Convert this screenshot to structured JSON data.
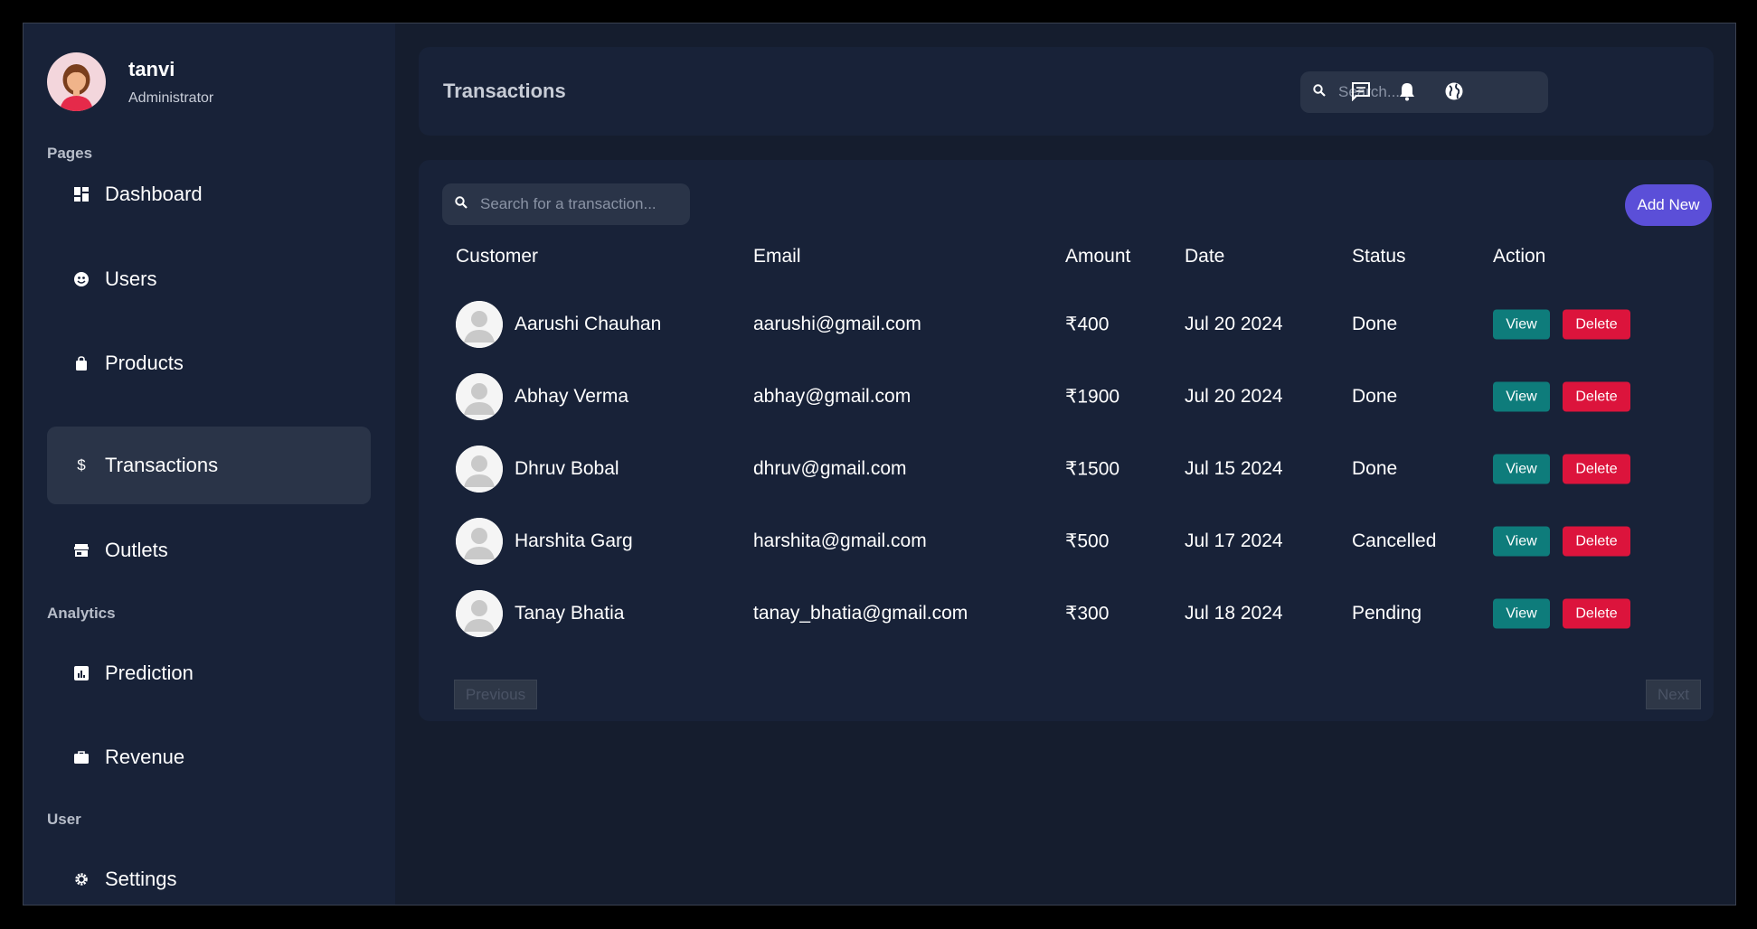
{
  "profile": {
    "name": "tanvi",
    "role": "Administrator"
  },
  "sidebar": {
    "sections": {
      "pages": "Pages",
      "analytics": "Analytics",
      "user": "User"
    },
    "items": [
      {
        "label": "Dashboard",
        "icon": "dashboard-icon"
      },
      {
        "label": "Users",
        "icon": "users-icon"
      },
      {
        "label": "Products",
        "icon": "bag-icon"
      },
      {
        "label": "Transactions",
        "icon": "dollar-icon",
        "active": true
      },
      {
        "label": "Outlets",
        "icon": "store-icon"
      },
      {
        "label": "Prediction",
        "icon": "chart-icon"
      },
      {
        "label": "Revenue",
        "icon": "briefcase-icon"
      },
      {
        "label": "Settings",
        "icon": "gear-icon"
      }
    ]
  },
  "header": {
    "title": "Transactions",
    "search_placeholder": "Search...",
    "icons": [
      "message-icon",
      "bell-icon",
      "globe-icon"
    ]
  },
  "transactions": {
    "search_placeholder": "Search for a transaction...",
    "add_label": "Add New",
    "columns": [
      "Customer",
      "Email",
      "Amount",
      "Date",
      "Status",
      "Action"
    ],
    "rows": [
      {
        "customer": "Aarushi Chauhan",
        "email": "aarushi@gmail.com",
        "amount": "₹400",
        "date": "Jul 20 2024",
        "status": "Done"
      },
      {
        "customer": "Abhay Verma",
        "email": "abhay@gmail.com",
        "amount": "₹1900",
        "date": "Jul 20 2024",
        "status": "Done"
      },
      {
        "customer": "Dhruv Bobal",
        "email": "dhruv@gmail.com",
        "amount": "₹1500",
        "date": "Jul 15 2024",
        "status": "Done"
      },
      {
        "customer": "Harshita Garg",
        "email": "harshita@gmail.com",
        "amount": "₹500",
        "date": "Jul 17 2024",
        "status": "Cancelled"
      },
      {
        "customer": "Tanay Bhatia",
        "email": "tanay_bhatia@gmail.com",
        "amount": "₹300",
        "date": "Jul 18 2024",
        "status": "Pending"
      }
    ],
    "view_label": "View",
    "delete_label": "Delete",
    "previous_label": "Previous",
    "next_label": "Next"
  },
  "colors": {
    "accent": "#5b4fd8",
    "view": "#0e7c7b",
    "delete": "#dc143c"
  }
}
